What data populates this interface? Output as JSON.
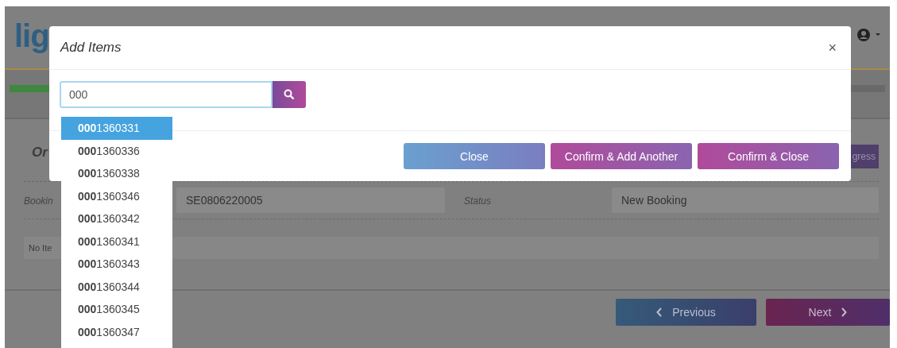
{
  "page": {
    "logo": "lig",
    "progress": {
      "level": 0.05
    },
    "heading": "Or",
    "booking_label": "Bookin",
    "booking_value": "SE0806220005",
    "status_label": "Status",
    "status_value": "New Booking",
    "items_notice": "No Ite",
    "progress_button": "gress",
    "previous": "Previous",
    "next": "Next"
  },
  "modal": {
    "title": "Add Items",
    "close": "×",
    "search": {
      "value": "000"
    },
    "suggestions": [
      {
        "text": "**000**1360331",
        "selected": true
      },
      {
        "text": "**000**1360336",
        "selected": false
      },
      {
        "text": "**000**1360338",
        "selected": false
      },
      {
        "text": "**000**1360346",
        "selected": false
      },
      {
        "text": "**000**1360342",
        "selected": false
      },
      {
        "text": "**000**1360341",
        "selected": false
      },
      {
        "text": "**000**1360343",
        "selected": false
      },
      {
        "text": "**000**1360344",
        "selected": false
      },
      {
        "text": "**000**1360345",
        "selected": false
      },
      {
        "text": "**000**1360347",
        "selected": false
      }
    ],
    "buttons": [
      {
        "label": "Close",
        "kind": "secondary"
      },
      {
        "label": "Confirm & Add Another",
        "kind": "primary"
      },
      {
        "label": "Confirm & Close",
        "kind": "primary"
      }
    ]
  }
}
